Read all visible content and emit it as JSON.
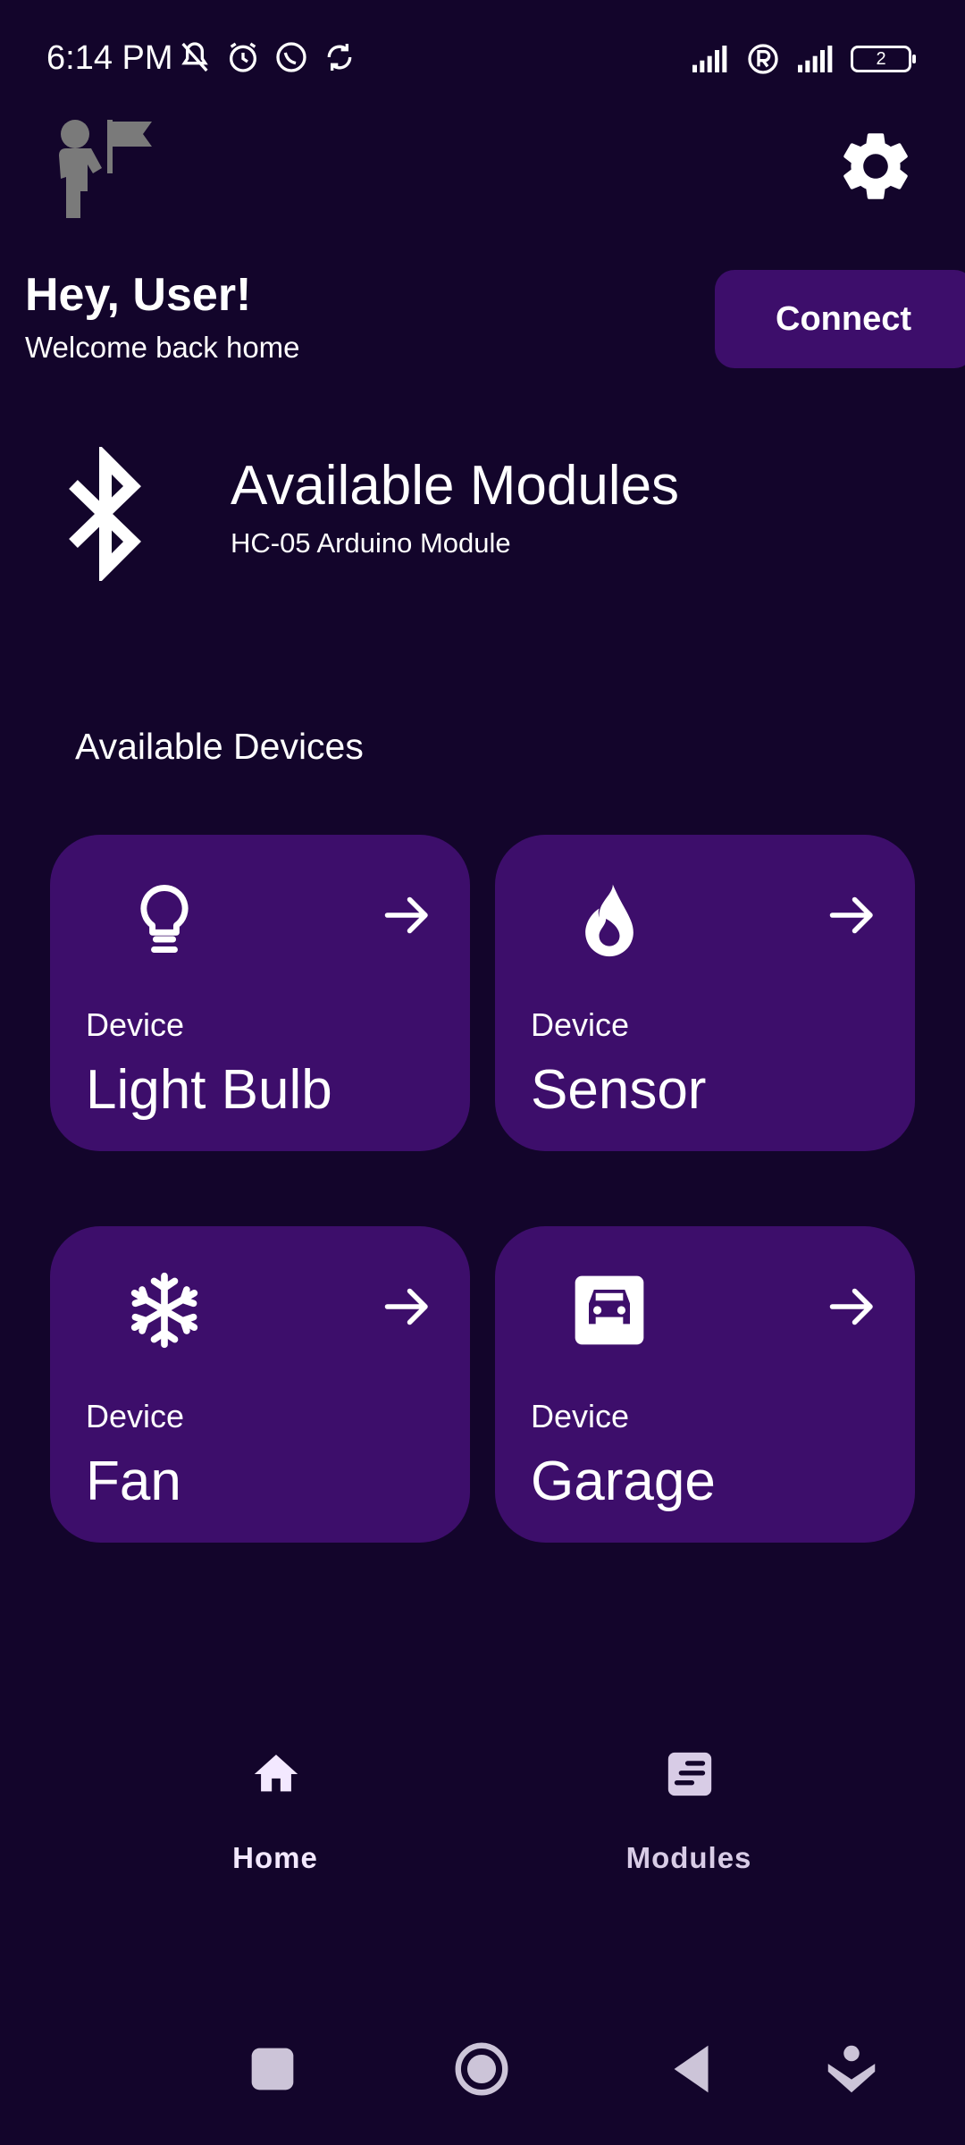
{
  "status_bar": {
    "time": "6:14 PM",
    "battery": "2"
  },
  "header": {
    "greeting": "Hey, User!",
    "subtitle": "Welcome back home",
    "connect_label": "Connect"
  },
  "modules": {
    "title": "Available Modules",
    "subtitle": "HC-05 Arduino Module"
  },
  "devices": {
    "heading": "Available Devices",
    "items": [
      {
        "kind": "Device",
        "name": "Light Bulb",
        "icon": "lightbulb-icon"
      },
      {
        "kind": "Device",
        "name": "Sensor",
        "icon": "flame-icon"
      },
      {
        "kind": "Device",
        "name": "Fan",
        "icon": "snowflake-icon"
      },
      {
        "kind": "Device",
        "name": "Garage",
        "icon": "car-icon"
      }
    ]
  },
  "bottom_nav": {
    "items": [
      {
        "label": "Home",
        "active": true,
        "icon": "home-icon"
      },
      {
        "label": "Modules",
        "active": false,
        "icon": "notes-icon"
      }
    ]
  },
  "colors": {
    "background": "#13052b",
    "card": "#3d0e6b",
    "nav_active": "#f3e8ff",
    "nav_inactive": "#d8cce6"
  }
}
